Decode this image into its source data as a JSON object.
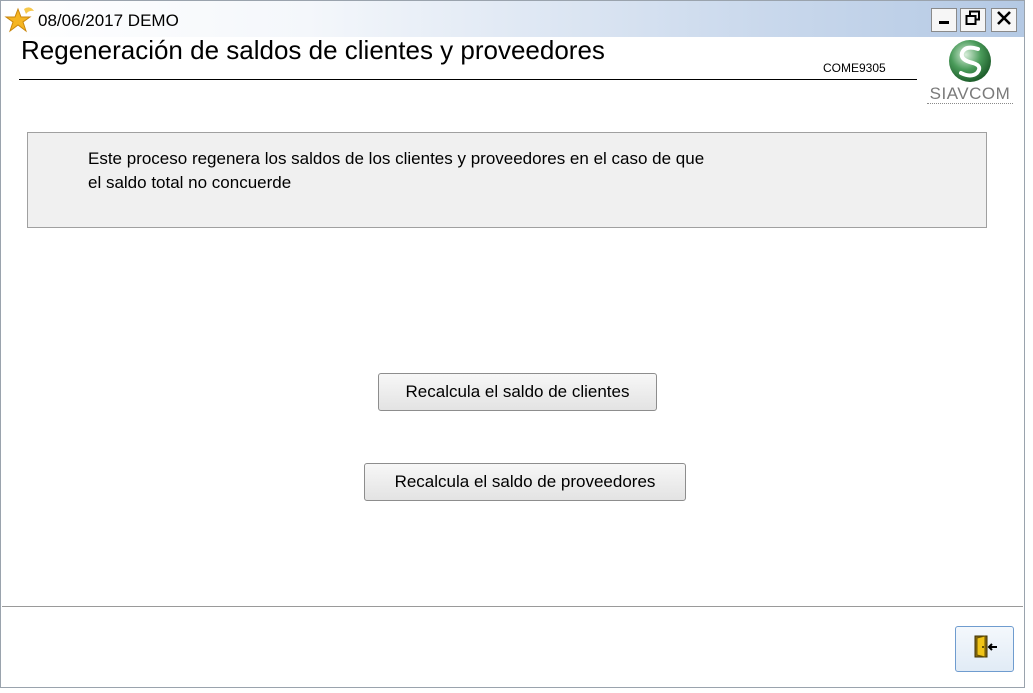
{
  "titlebar": {
    "date_demo": "08/06/2017  DEMO"
  },
  "header": {
    "title": "Regeneración de saldos de clientes y proveedores",
    "form_code": "COME9305",
    "logo_text": "SIAVCOM"
  },
  "info": {
    "line1": "Este proceso regenera los saldos de los clientes y proveedores en el caso de que",
    "line2": "el saldo total no concuerde"
  },
  "actions": {
    "recalc_clientes": "Recalcula el saldo de clientes",
    "recalc_proveedores": "Recalcula el saldo de proveedores"
  },
  "icons": {
    "app": "star-fairy-icon",
    "minimize": "minimize-icon",
    "maximize": "restore-icon",
    "close": "close-icon",
    "exit": "exit-door-icon"
  },
  "colors": {
    "titlebar_gradient_end": "#b4c9e4",
    "logo_green": "#3a8f4a",
    "info_bg": "#f0f0f0"
  }
}
